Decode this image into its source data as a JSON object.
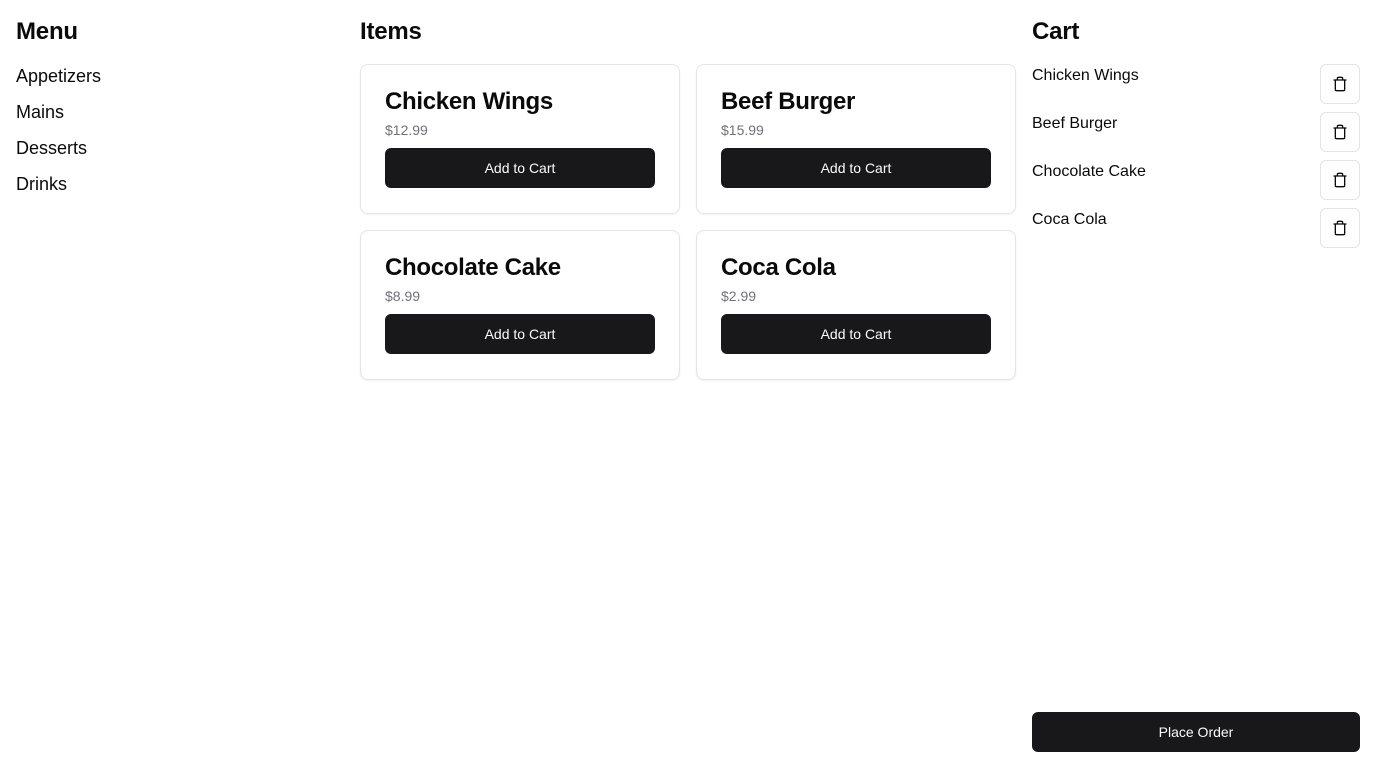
{
  "menu": {
    "title": "Menu",
    "items": [
      {
        "label": "Appetizers"
      },
      {
        "label": "Mains"
      },
      {
        "label": "Desserts"
      },
      {
        "label": "Drinks"
      }
    ]
  },
  "items": {
    "title": "Items",
    "products": [
      {
        "name": "Chicken Wings",
        "price": "$12.99",
        "button": "Add to Cart"
      },
      {
        "name": "Beef Burger",
        "price": "$15.99",
        "button": "Add to Cart"
      },
      {
        "name": "Chocolate Cake",
        "price": "$8.99",
        "button": "Add to Cart"
      },
      {
        "name": "Coca Cola",
        "price": "$2.99",
        "button": "Add to Cart"
      }
    ]
  },
  "cart": {
    "title": "Cart",
    "items": [
      {
        "name": "Chicken Wings",
        "icon": "trash-icon"
      },
      {
        "name": "Beef Burger",
        "icon": "trash-icon"
      },
      {
        "name": "Chocolate Cake",
        "icon": "trash-icon"
      },
      {
        "name": "Coca Cola",
        "icon": "trash-icon"
      }
    ],
    "place_order_label": "Place Order"
  },
  "colors": {
    "button_bg": "#18181b",
    "button_text": "#fafafa",
    "border": "#e4e4e7",
    "muted_text": "#71717a"
  }
}
